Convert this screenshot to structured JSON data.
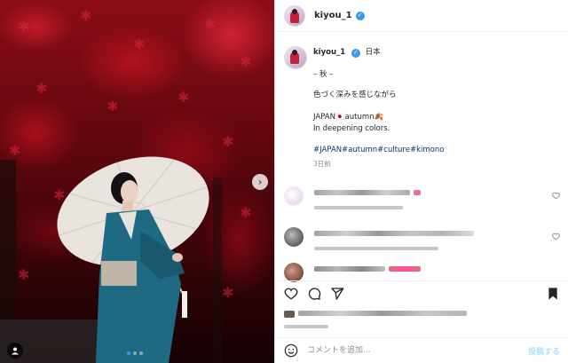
{
  "post": {
    "username": "kiyou_1",
    "verified": true,
    "photo_alt_icon": "photo-of-woman-with-umbrella",
    "carousel": {
      "current": 1,
      "total": 3
    }
  },
  "caption": {
    "username": "kiyou_1",
    "location": "日本",
    "line1": "– 秋 –",
    "line2": "色づく深みを感じながら",
    "line3": "JAPAN🇯🇵autumn🍂",
    "line4": "In deepening colors.",
    "hashtags": "#JAPAN#autumn#culture#kimono",
    "time": "3日前"
  },
  "comments": [
    {
      "avatar_color": "#f3e9f7",
      "accent": "#e1306c"
    },
    {
      "avatar_color": "#6b6b6b",
      "accent": "#999999"
    },
    {
      "avatar_color": "#8a5a3b",
      "accent": "#e0323c"
    }
  ],
  "comment_box": {
    "placeholder": "コメントを追加...",
    "post_label": "投稿する"
  },
  "colors": {
    "link": "#00376b",
    "verified": "#3897f0",
    "post_disabled": "#b2dffc",
    "muted": "#8e8e8e"
  },
  "icons": [
    "heart-icon",
    "comment-icon",
    "share-icon",
    "bookmark-icon",
    "emoji-icon",
    "chevron-right-icon",
    "user-tag-icon",
    "verified-icon"
  ]
}
